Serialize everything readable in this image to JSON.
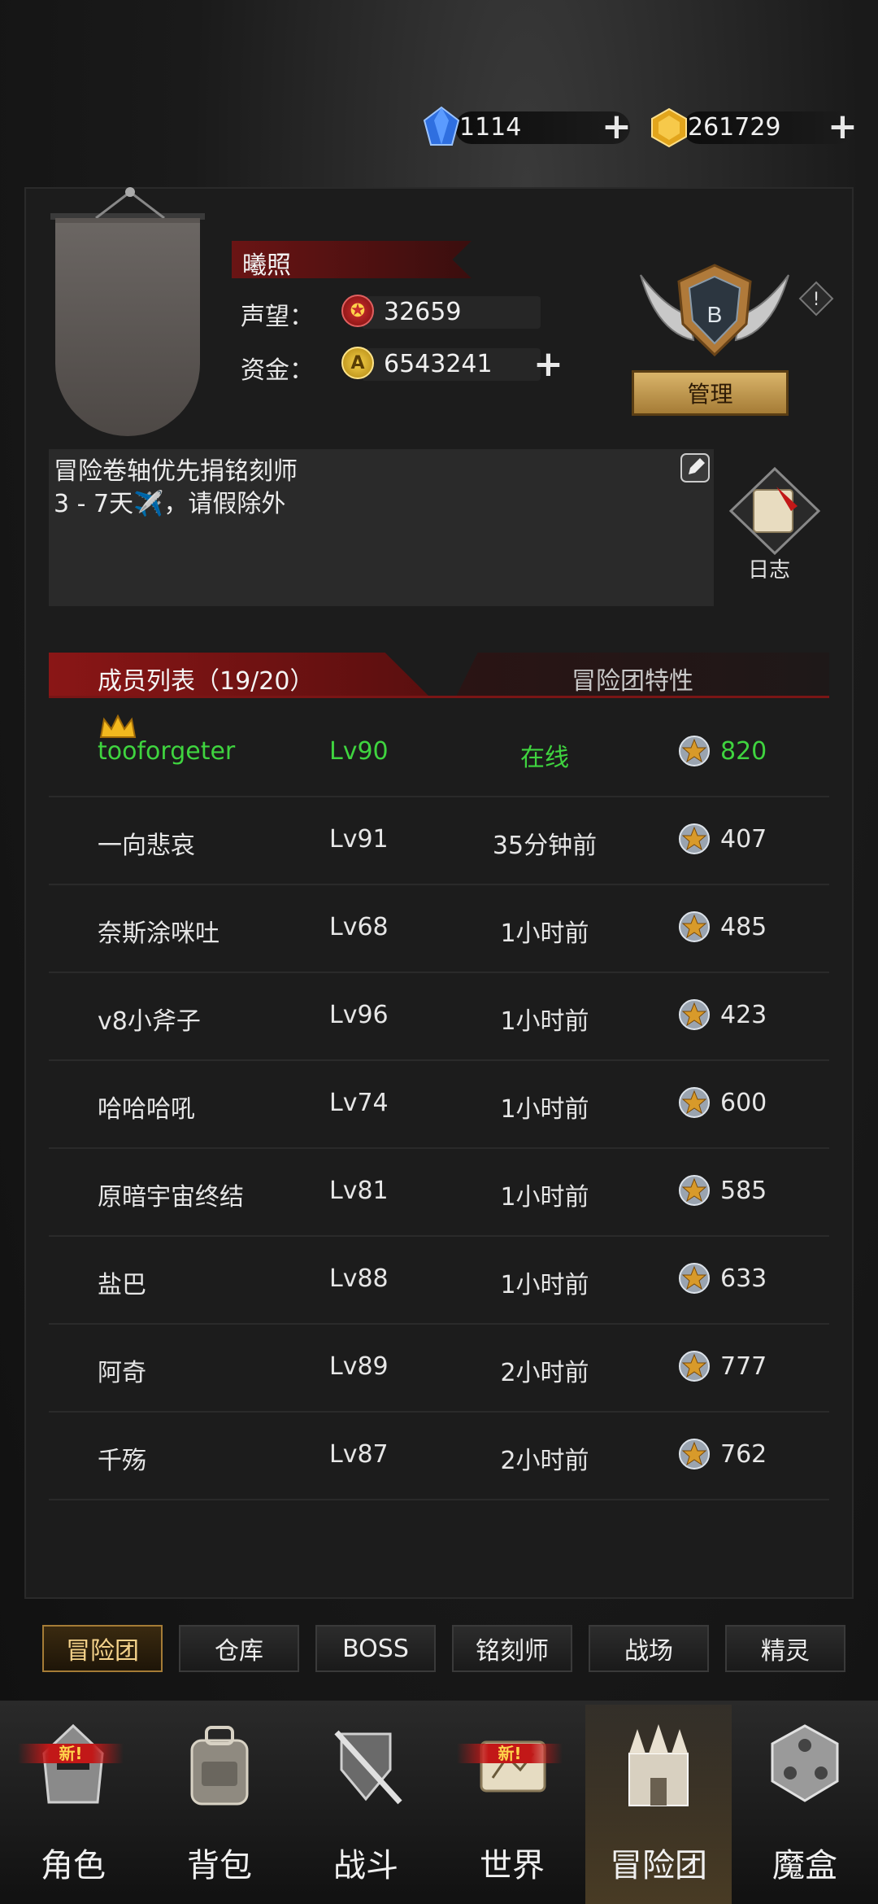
{
  "currency": {
    "diamonds": "1114",
    "gold": "261729"
  },
  "guild": {
    "name": "曦照",
    "reputation_label": "声望：",
    "reputation": "32659",
    "funds_label": "资金：",
    "funds": "6543241",
    "rank": "B",
    "manage_label": "管理",
    "notice": "冒险卷轴优先捐铭刻师\n3 - 7天✈️，请假除外",
    "log_label": "日志"
  },
  "tabs": {
    "members": "成员列表（19/20）",
    "traits": "冒险团特性"
  },
  "members": [
    {
      "name": "tooforgeter",
      "level": "Lv90",
      "status": "在线",
      "points": "820",
      "leader": true,
      "online": true
    },
    {
      "name": "一向悲哀",
      "level": "Lv91",
      "status": "35分钟前",
      "points": "407"
    },
    {
      "name": "奈斯涂咪吐",
      "level": "Lv68",
      "status": "1小时前",
      "points": "485"
    },
    {
      "name": "v8小斧子",
      "level": "Lv96",
      "status": "1小时前",
      "points": "423"
    },
    {
      "name": "哈哈哈吼",
      "level": "Lv74",
      "status": "1小时前",
      "points": "600"
    },
    {
      "name": "原暗宇宙终结",
      "level": "Lv81",
      "status": "1小时前",
      "points": "585"
    },
    {
      "name": "盐巴",
      "level": "Lv88",
      "status": "1小时前",
      "points": "633"
    },
    {
      "name": "阿奇",
      "level": "Lv89",
      "status": "2小时前",
      "points": "777"
    },
    {
      "name": "千殇",
      "level": "Lv87",
      "status": "2小时前",
      "points": "762"
    }
  ],
  "sub_buttons": [
    "冒险团",
    "仓库",
    "BOSS",
    "铭刻师",
    "战场",
    "精灵"
  ],
  "nav": [
    {
      "label": "角色",
      "icon": "helmet-icon",
      "new": true
    },
    {
      "label": "背包",
      "icon": "backpack-icon",
      "new": false
    },
    {
      "label": "战斗",
      "icon": "sword-shield-icon",
      "new": false
    },
    {
      "label": "世界",
      "icon": "map-scroll-icon",
      "new": true
    },
    {
      "label": "冒险团",
      "icon": "castle-icon",
      "new": false
    },
    {
      "label": "魔盒",
      "icon": "cube-icon",
      "new": false
    }
  ],
  "new_badge": "新!",
  "colors": {
    "online_green": "#3fd43f",
    "accent_red": "#8a1616",
    "gold_button": "#d9b46a"
  }
}
